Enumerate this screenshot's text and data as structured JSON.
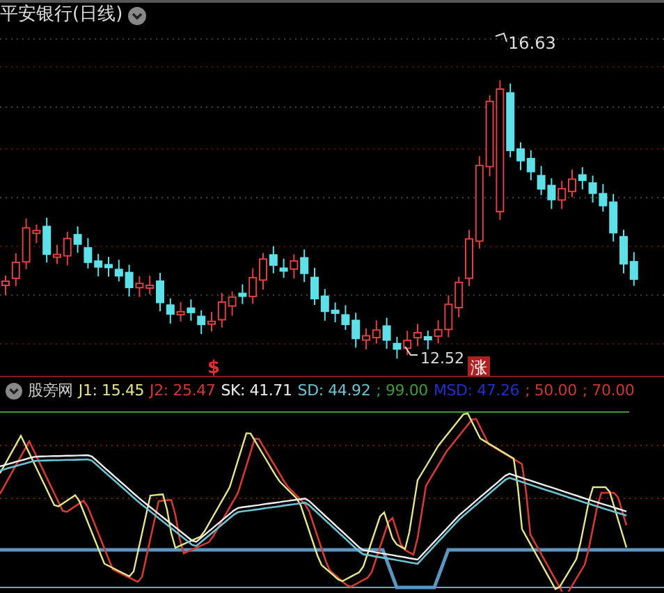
{
  "title": "平安银行(日线)",
  "price_chart": {
    "high_label": "16.63",
    "low_label": "12.52",
    "signals": [
      {
        "kind": "sell",
        "text": "$"
      },
      {
        "kind": "rise",
        "text": "涨"
      }
    ]
  },
  "indicator": {
    "name": "股旁网",
    "values": [
      {
        "text": "J1: 15.45",
        "color": "#e6e68c"
      },
      {
        "text": "J2: 25.47",
        "color": "#d23a32"
      },
      {
        "text": "SK: 41.71",
        "color": "#f0f0f0"
      },
      {
        "text": "SD: 44.92",
        "color": "#6cc4d2"
      },
      {
        "text": "; 99.00",
        "color": "#3f9a3a"
      },
      {
        "text": "MSD: 47.26",
        "color": "#2030c8"
      },
      {
        "text": "; 50.00",
        "color": "#c83a30"
      },
      {
        "text": "; 70.00",
        "color": "#c83a30"
      }
    ]
  }
}
